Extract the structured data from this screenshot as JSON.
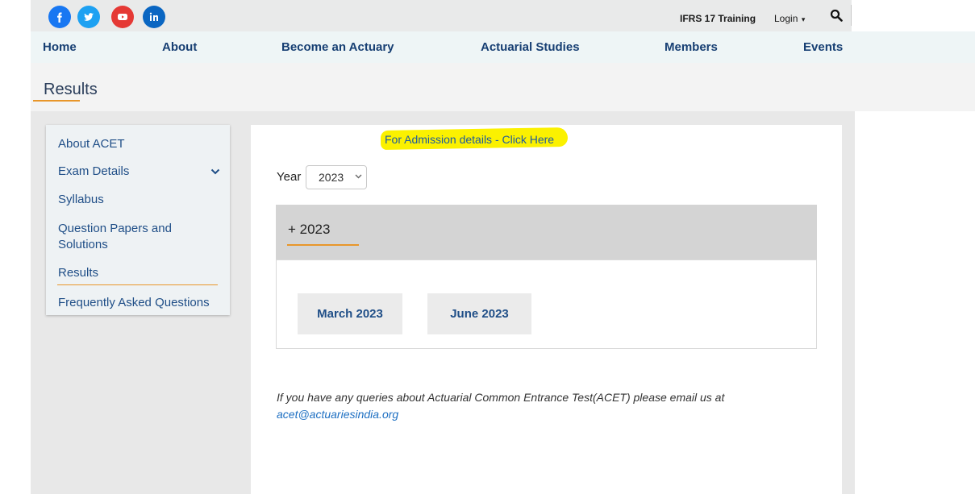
{
  "social": [
    {
      "name": "facebook-icon",
      "color": "#1877f2"
    },
    {
      "name": "twitter-icon",
      "color": "#1da1f2"
    },
    {
      "name": "youtube-icon",
      "color": "#e53935"
    },
    {
      "name": "linkedin-icon",
      "color": "#0a66c2"
    }
  ],
  "topbar": {
    "ifrs_label": "IFRS 17 Training",
    "login_label": "Login"
  },
  "nav": {
    "home": "Home",
    "about": "About",
    "become": "Become an Actuary",
    "studies": "Actuarial Studies",
    "members": "Members",
    "events": "Events"
  },
  "page": {
    "title": "Results"
  },
  "sidebar": {
    "items": [
      {
        "label": "About ACET"
      },
      {
        "label": "Exam Details"
      },
      {
        "label": "Syllabus"
      },
      {
        "label": "Question Papers and Solutions"
      },
      {
        "label": "Results"
      },
      {
        "label": "Frequently Asked Questions"
      }
    ]
  },
  "content": {
    "admission_link": "For Admission details - Click Here",
    "year_label": "Year",
    "year_selected": "2023",
    "accordion_title": "+ 2023",
    "buttons": [
      "March 2023",
      "June 2023"
    ],
    "query_text": "If you have any queries about Actuarial Common Entrance Test(ACET) please email us at",
    "query_email": "acet@actuariesindia.org"
  },
  "colors": {
    "accent": "#e8962a",
    "nav_text": "#173f73",
    "link": "#1d5a9e",
    "highlight": "#fbf100"
  }
}
